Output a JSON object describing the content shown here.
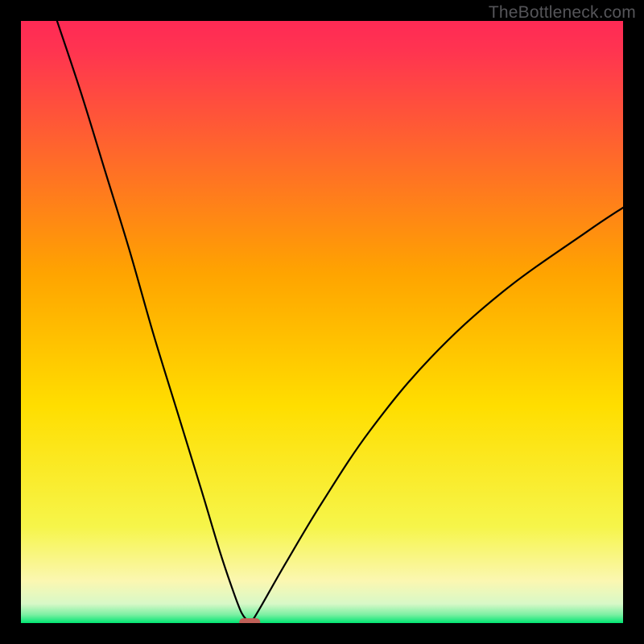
{
  "watermark": "TheBottleneck.com",
  "chart_data": {
    "type": "line",
    "title": "",
    "xlabel": "",
    "ylabel": "",
    "xlim": [
      0,
      100
    ],
    "ylim": [
      0,
      100
    ],
    "grid": false,
    "legend": false,
    "gradient_top_color": "#ff2a55",
    "gradient_mid_color": "#ffde00",
    "gradient_low_color": "#fbf7b1",
    "gradient_bottom_color": "#00e572",
    "series": [
      {
        "name": "bottleneck-curve",
        "color": "#000000",
        "x": [
          6,
          10,
          14,
          18,
          22,
          26,
          30,
          33,
          35,
          36.5,
          37.5,
          38,
          38.5,
          40,
          44,
          50,
          58,
          68,
          80,
          94,
          100
        ],
        "y": [
          100,
          88,
          75,
          62,
          48,
          35,
          22,
          12,
          6,
          2,
          0.5,
          0,
          0.5,
          3,
          10,
          20,
          32,
          44,
          55,
          65,
          69
        ]
      }
    ],
    "marker": {
      "name": "minimum-marker",
      "shape": "rounded-rect",
      "color": "#c06058",
      "x": 38,
      "y": 0,
      "width": 3.5,
      "height": 1.6
    }
  }
}
